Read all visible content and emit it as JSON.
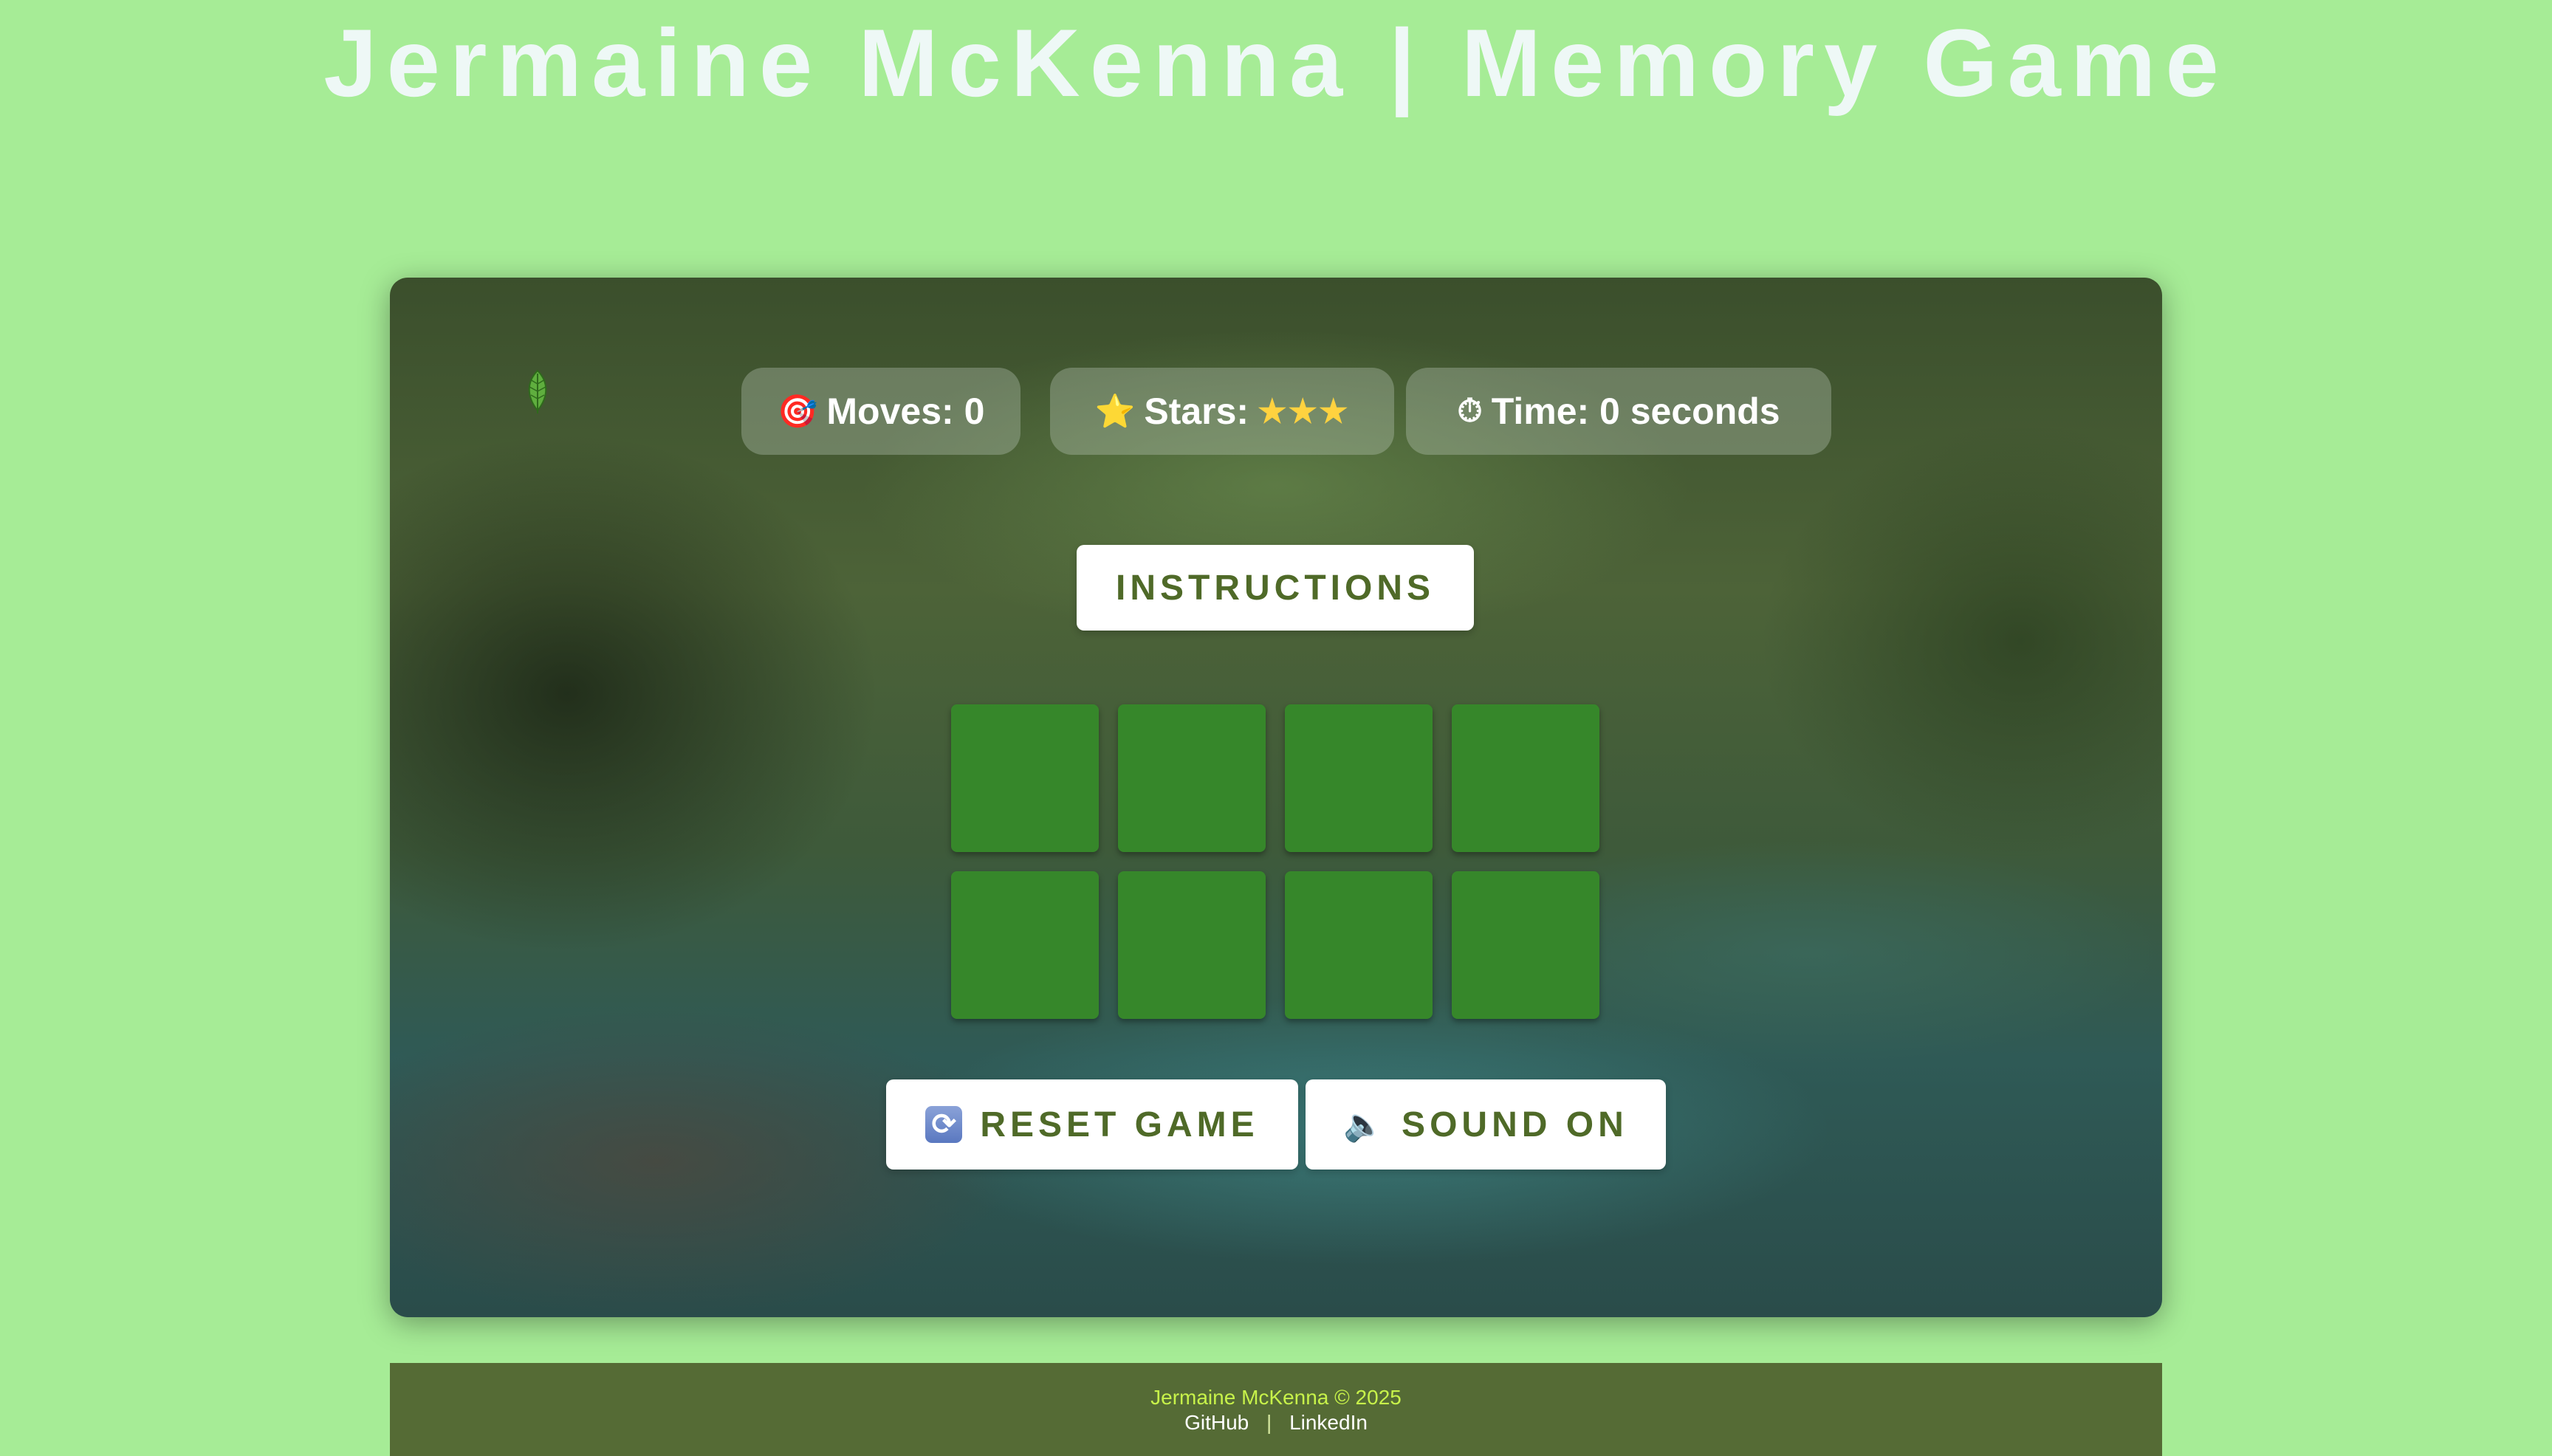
{
  "header": {
    "title": "Jermaine McKenna | Memory Game"
  },
  "stats": {
    "moves_label": "Moves: 0",
    "moves_icon": "target-icon",
    "stars_label": "Stars:",
    "stars_value": "★★★",
    "stars_icon": "star-icon",
    "time_label": "Time: 0 seconds",
    "time_icon": "stopwatch-icon"
  },
  "buttons": {
    "instructions_label": "INSTRUCTIONS",
    "reset_label": "RESET GAME",
    "reset_icon": "refresh-icon",
    "sound_label": "SOUND ON",
    "sound_icon": "speaker-icon"
  },
  "cards": {
    "count": 8,
    "face_down_color": "#36872a"
  },
  "footer": {
    "copyright": "Jermaine McKenna © 2025",
    "github_label": "GitHub",
    "separator": "|",
    "linkedin_label": "LinkedIn"
  },
  "colors": {
    "page_background": "#a6ec96",
    "button_text": "#4f6a28",
    "footer_background": "#556b35",
    "footer_copy": "#c7f24a"
  }
}
